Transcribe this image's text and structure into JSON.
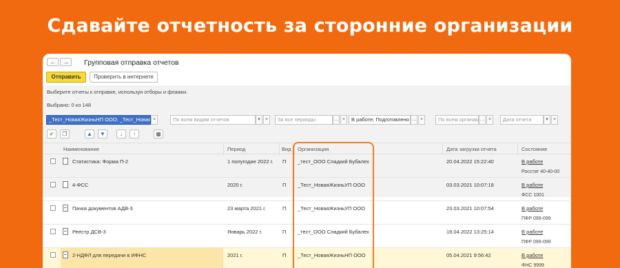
{
  "banner": {
    "title": "Сдавайте отчетность за сторонние организации"
  },
  "window": {
    "nav": {
      "back": "←",
      "forward": "→"
    },
    "title": "Групповая отправка отчетов",
    "toolbar": {
      "send_label": "Отправить",
      "check_label": "Проверить в интернете"
    },
    "hint": "Выберите отчеты к отправке, используя отборы и флажки.",
    "selected": "Выбрано: 0 из 148",
    "filters": {
      "organization": "_Тест_НоваяЖизньНП ООО; _Тест_НоваяЖ...",
      "report_type_placeholder": "По всем видам отчетов",
      "period_placeholder": "За все периоды",
      "status": "В работе; Подготовлено",
      "agency_placeholder": "По всем органам",
      "date_placeholder": "Дата отчета"
    }
  },
  "icons": {
    "check_all": "check-all-icon",
    "copy": "copy-icon",
    "up": "arrow-up-icon",
    "down": "arrow-down-icon",
    "sort_az": "sort-az-icon",
    "sort_za": "sort-za-icon",
    "table": "table-settings-icon"
  },
  "table": {
    "columns": [
      "Наименование",
      "Период",
      "Вид",
      "Организация",
      "Дата загрузки отчета",
      "Состояние"
    ],
    "rows": [
      {
        "name": "Статистика: Форма П-2",
        "period": "1 полугодие 2022 г.",
        "kind": "П",
        "org": "_тест_ООО Сладкий Бубалех",
        "date": "20.04.2022 15:22:40",
        "state": "В работе",
        "agency": "Росстат 40-40-00"
      },
      {
        "name": "4-ФСС",
        "period": "2020 г.",
        "kind": "П",
        "org": "_Тест_НоваяЖизньУП ООО",
        "date": "03.03.2021 10:07:18",
        "state": "В работе",
        "agency": "ФСС 1001"
      },
      {
        "name": "Пачка документов АДВ-3",
        "period": "23 марта 2021 г.",
        "kind": "П",
        "org": "_Тест_НоваяЖизньУП ООО",
        "date": "23.03.2021 10:07:54",
        "state": "В работе",
        "agency": "ПФР 099-099"
      },
      {
        "name": "Реестр ДСВ-3",
        "period": "Январь 2022 г.",
        "kind": "П",
        "org": "_тест_ООО Сладкий Бубалех",
        "date": "19.04.2022 13:25:14",
        "state": "В работе",
        "agency": "ПФР 099-099"
      },
      {
        "name": "2-НДФЛ для передачи в ИФНС",
        "period": "2021 г.",
        "kind": "П",
        "org": "_Тест_НоваяЖизньНП ООО",
        "date": "05.04.2021 9:56:42",
        "state": "В работе",
        "agency": "ФНС 9999"
      }
    ]
  },
  "colors": {
    "background": "#f26a10",
    "send_button": "#f6d93a",
    "highlight_frame": "#f07a1e",
    "selected_row": "#fff7d6"
  }
}
